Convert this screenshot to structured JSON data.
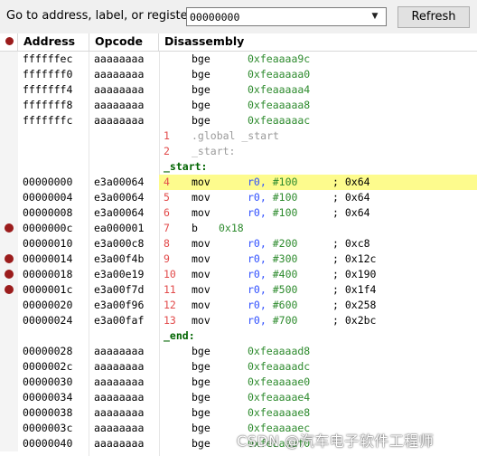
{
  "toolbar": {
    "goto_label": "Go to address, label, or register:",
    "address_value": "00000000",
    "refresh_label": "Refresh"
  },
  "columns": {
    "address": "Address",
    "opcode": "Opcode",
    "disassembly": "Disassembly"
  },
  "rows": [
    {
      "kind": "inst",
      "addr": "ffffffec",
      "op": "aaaaaaaa",
      "line": "",
      "mn": "bge",
      "reg": "",
      "imm": "0xfeaaaa9c",
      "comment": "",
      "bp": false,
      "current": false
    },
    {
      "kind": "inst",
      "addr": "fffffff0",
      "op": "aaaaaaaa",
      "line": "",
      "mn": "bge",
      "reg": "",
      "imm": "0xfeaaaaa0",
      "comment": "",
      "bp": false,
      "current": false
    },
    {
      "kind": "inst",
      "addr": "fffffff4",
      "op": "aaaaaaaa",
      "line": "",
      "mn": "bge",
      "reg": "",
      "imm": "0xfeaaaaa4",
      "comment": "",
      "bp": false,
      "current": false
    },
    {
      "kind": "inst",
      "addr": "fffffff8",
      "op": "aaaaaaaa",
      "line": "",
      "mn": "bge",
      "reg": "",
      "imm": "0xfeaaaaa8",
      "comment": "",
      "bp": false,
      "current": false
    },
    {
      "kind": "inst",
      "addr": "fffffffc",
      "op": "aaaaaaaa",
      "line": "",
      "mn": "bge",
      "reg": "",
      "imm": "0xfeaaaaac",
      "comment": "",
      "bp": false,
      "current": false
    },
    {
      "kind": "source",
      "line": "1",
      "text": ".global _start"
    },
    {
      "kind": "source",
      "line": "2",
      "text": "_start:"
    },
    {
      "kind": "label",
      "text": "_start:"
    },
    {
      "kind": "inst",
      "addr": "00000000",
      "op": "e3a00064",
      "line": "4",
      "mn": "mov",
      "reg": "r0,",
      "imm": "#100",
      "comment": "; 0x64",
      "bp": false,
      "current": true
    },
    {
      "kind": "inst",
      "addr": "00000004",
      "op": "e3a00064",
      "line": "5",
      "mn": "mov",
      "reg": "r0,",
      "imm": "#100",
      "comment": "; 0x64",
      "bp": false,
      "current": false
    },
    {
      "kind": "inst",
      "addr": "00000008",
      "op": "e3a00064",
      "line": "6",
      "mn": "mov",
      "reg": "r0,",
      "imm": "#100",
      "comment": "; 0x64",
      "bp": false,
      "current": false
    },
    {
      "kind": "inst",
      "addr": "0000000c",
      "op": "ea000001",
      "line": "7",
      "mn": "b",
      "reg": "",
      "imm": "0x18",
      "comment": "",
      "bp": true,
      "current": false
    },
    {
      "kind": "inst",
      "addr": "00000010",
      "op": "e3a000c8",
      "line": "8",
      "mn": "mov",
      "reg": "r0,",
      "imm": "#200",
      "comment": "; 0xc8",
      "bp": false,
      "current": false
    },
    {
      "kind": "inst",
      "addr": "00000014",
      "op": "e3a00f4b",
      "line": "9",
      "mn": "mov",
      "reg": "r0,",
      "imm": "#300",
      "comment": "; 0x12c",
      "bp": true,
      "current": false
    },
    {
      "kind": "inst",
      "addr": "00000018",
      "op": "e3a00e19",
      "line": "10",
      "mn": "mov",
      "reg": "r0,",
      "imm": "#400",
      "comment": "; 0x190",
      "bp": true,
      "current": false
    },
    {
      "kind": "inst",
      "addr": "0000001c",
      "op": "e3a00f7d",
      "line": "11",
      "mn": "mov",
      "reg": "r0,",
      "imm": "#500",
      "comment": "; 0x1f4",
      "bp": true,
      "current": false
    },
    {
      "kind": "inst",
      "addr": "00000020",
      "op": "e3a00f96",
      "line": "12",
      "mn": "mov",
      "reg": "r0,",
      "imm": "#600",
      "comment": "; 0x258",
      "bp": false,
      "current": false
    },
    {
      "kind": "inst",
      "addr": "00000024",
      "op": "e3a00faf",
      "line": "13",
      "mn": "mov",
      "reg": "r0,",
      "imm": "#700",
      "comment": "; 0x2bc",
      "bp": false,
      "current": false
    },
    {
      "kind": "label",
      "text": "_end:"
    },
    {
      "kind": "inst",
      "addr": "00000028",
      "op": "aaaaaaaa",
      "line": "",
      "mn": "bge",
      "reg": "",
      "imm": "0xfeaaaad8",
      "comment": "",
      "bp": false,
      "current": false
    },
    {
      "kind": "inst",
      "addr": "0000002c",
      "op": "aaaaaaaa",
      "line": "",
      "mn": "bge",
      "reg": "",
      "imm": "0xfeaaaadc",
      "comment": "",
      "bp": false,
      "current": false
    },
    {
      "kind": "inst",
      "addr": "00000030",
      "op": "aaaaaaaa",
      "line": "",
      "mn": "bge",
      "reg": "",
      "imm": "0xfeaaaae0",
      "comment": "",
      "bp": false,
      "current": false
    },
    {
      "kind": "inst",
      "addr": "00000034",
      "op": "aaaaaaaa",
      "line": "",
      "mn": "bge",
      "reg": "",
      "imm": "0xfeaaaae4",
      "comment": "",
      "bp": false,
      "current": false
    },
    {
      "kind": "inst",
      "addr": "00000038",
      "op": "aaaaaaaa",
      "line": "",
      "mn": "bge",
      "reg": "",
      "imm": "0xfeaaaae8",
      "comment": "",
      "bp": false,
      "current": false
    },
    {
      "kind": "inst",
      "addr": "0000003c",
      "op": "aaaaaaaa",
      "line": "",
      "mn": "bge",
      "reg": "",
      "imm": "0xfeaaaaec",
      "comment": "",
      "bp": false,
      "current": false
    },
    {
      "kind": "inst",
      "addr": "00000040",
      "op": "aaaaaaaa",
      "line": "",
      "mn": "bge",
      "reg": "",
      "imm": "0xfeaaaaf0",
      "comment": "",
      "bp": false,
      "current": false
    }
  ],
  "watermark": "CSDN @汽车电子软件工程师",
  "colors": {
    "current_line": "#fdfb8d",
    "breakpoint": "#9b1c1c",
    "line_number": "#e24a4a",
    "register": "#2f4fff",
    "immediate": "#2e8b2e",
    "label": "#006400"
  }
}
